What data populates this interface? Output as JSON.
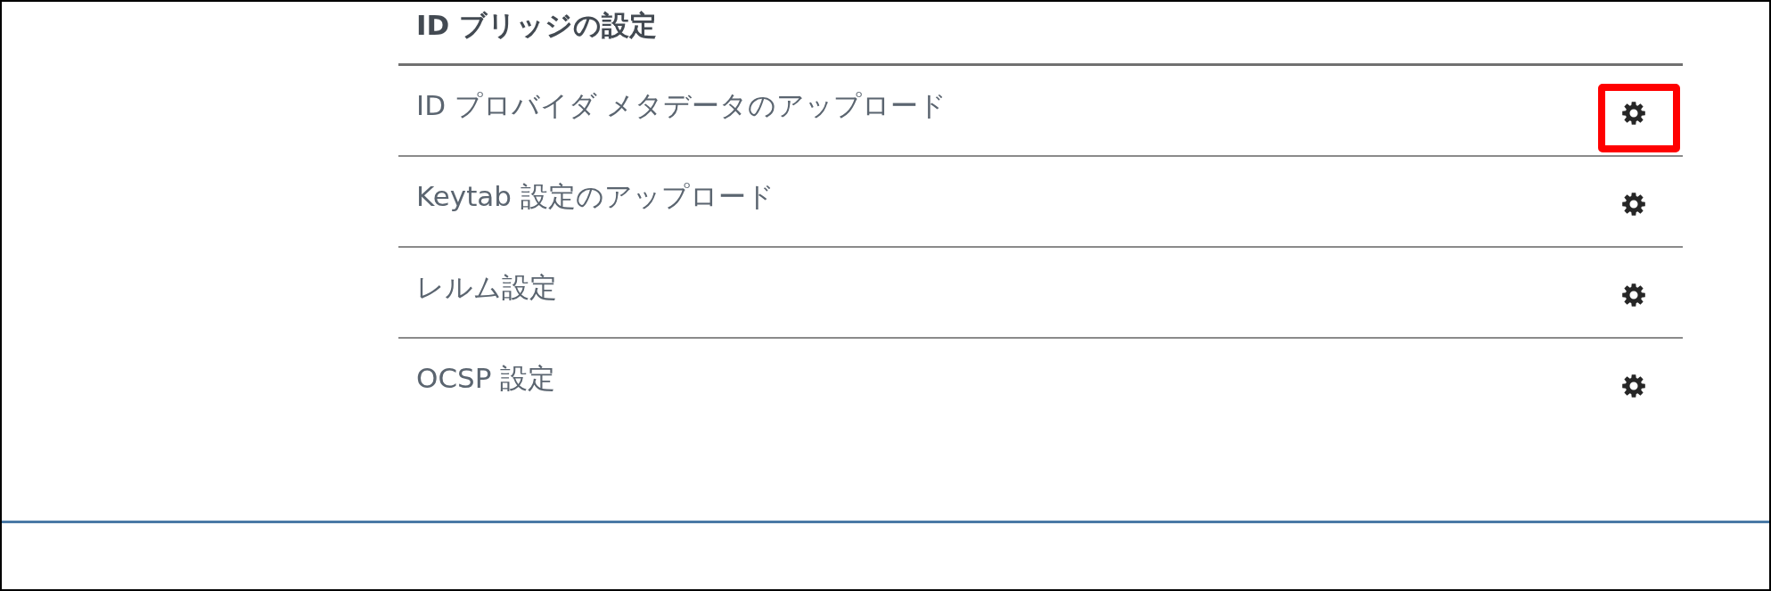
{
  "section": {
    "title": "ID ブリッジの設定"
  },
  "rows": [
    {
      "label": "ID プロバイダ メタデータのアップロード",
      "highlighted": true
    },
    {
      "label": "Keytab 設定のアップロード",
      "highlighted": false
    },
    {
      "label": "レルム設定",
      "highlighted": false
    },
    {
      "label": "OCSP 設定",
      "highlighted": false
    }
  ]
}
